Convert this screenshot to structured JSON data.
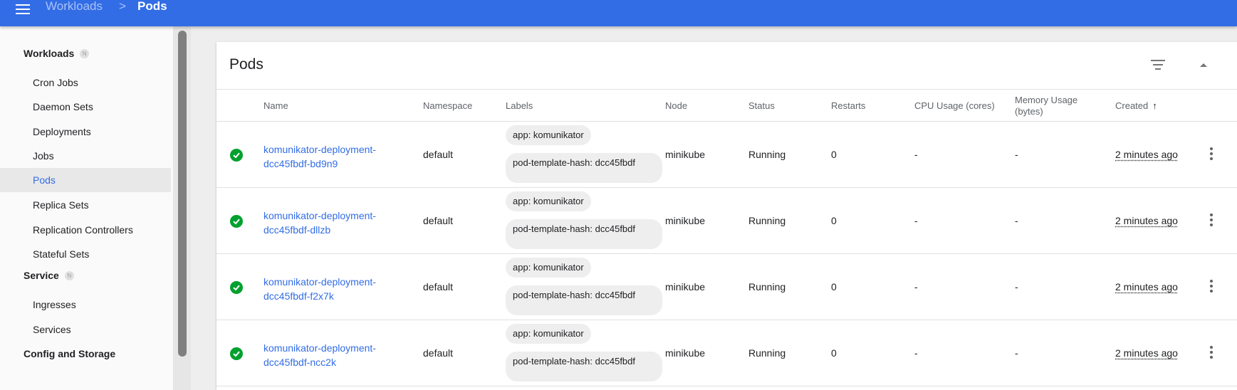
{
  "topbar": {
    "breadcrumb_parent": "Workloads",
    "breadcrumb_separator": ">",
    "breadcrumb_current": "Pods",
    "bar_color": "#326de6"
  },
  "sidebar": {
    "sections": [
      {
        "label": "Workloads",
        "badge": "N"
      },
      {
        "label": "Service",
        "badge": "N"
      },
      {
        "label": "Config and Storage"
      }
    ],
    "workload_items": [
      "Cron Jobs",
      "Daemon Sets",
      "Deployments",
      "Jobs",
      "Pods",
      "Replica Sets",
      "Replication Controllers",
      "Stateful Sets"
    ],
    "service_items": [
      "Ingresses",
      "Services"
    ],
    "active_item": "Pods"
  },
  "card": {
    "title": "Pods",
    "columns": [
      "Name",
      "Namespace",
      "Labels",
      "Node",
      "Status",
      "Restarts",
      "CPU Usage (cores)",
      "Memory Usage (bytes)",
      "Created"
    ],
    "sort_indicator": "↑",
    "rows": [
      {
        "name": "komunikator-deployment-dcc45fbdf-bd9n9",
        "namespace": "default",
        "label1": "app: komunikator",
        "label2": "pod-template-hash: dcc45fbdf",
        "node": "minikube",
        "status": "Running",
        "restarts": "0",
        "cpu": "-",
        "memory": "-",
        "created": "2 minutes ago"
      },
      {
        "name": "komunikator-deployment-dcc45fbdf-dllzb",
        "namespace": "default",
        "label1": "app: komunikator",
        "label2": "pod-template-hash: dcc45fbdf",
        "node": "minikube",
        "status": "Running",
        "restarts": "0",
        "cpu": "-",
        "memory": "-",
        "created": "2 minutes ago"
      },
      {
        "name": "komunikator-deployment-dcc45fbdf-f2x7k",
        "namespace": "default",
        "label1": "app: komunikator",
        "label2": "pod-template-hash: dcc45fbdf",
        "node": "minikube",
        "status": "Running",
        "restarts": "0",
        "cpu": "-",
        "memory": "-",
        "created": "2 minutes ago"
      },
      {
        "name": "komunikator-deployment-dcc45fbdf-ncc2k",
        "namespace": "default",
        "label1": "app: komunikator",
        "label2": "pod-template-hash: dcc45fbdf",
        "node": "minikube",
        "status": "Running",
        "restarts": "0",
        "cpu": "-",
        "memory": "-",
        "created": "2 minutes ago"
      }
    ]
  },
  "icons": {
    "menu": "hamburger-icon",
    "filter": "filter-icon",
    "collapse": "chevron-up-icon",
    "status_ok": "check-circle-icon",
    "row_menu": "more-vert-icon"
  },
  "colors": {
    "accent": "#326de6",
    "status_ok": "#00a12e"
  }
}
